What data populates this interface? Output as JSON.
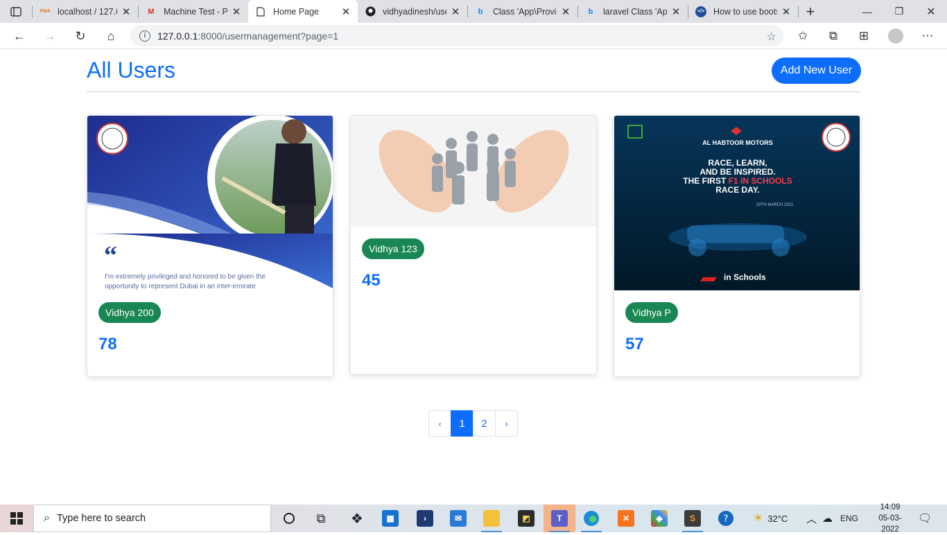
{
  "browser": {
    "tabs": [
      {
        "title": "localhost / 127.0.0",
        "icon": "phpmyadmin-icon",
        "icon_text": "PMA"
      },
      {
        "title": "Machine Test - Ph",
        "icon": "gmail-icon",
        "icon_text": "M"
      },
      {
        "title": "Home Page",
        "icon": "page-icon",
        "icon_text": ""
      },
      {
        "title": "vidhyadinesh/use",
        "icon": "github-icon",
        "icon_text": ""
      },
      {
        "title": "Class 'App\\Provid",
        "icon": "bing-icon",
        "icon_text": "b"
      },
      {
        "title": "laravel Class 'App",
        "icon": "bing-icon",
        "icon_text": "b"
      },
      {
        "title": "How to use boots",
        "icon": "code-icon",
        "icon_text": "</>"
      }
    ],
    "active_tab": 2,
    "url_host": "127.0.0.1",
    "url_rest": ":8000/usermanagement?page=1"
  },
  "page": {
    "title": "All Users",
    "add_button": "Add New User",
    "cards": [
      {
        "name": "Vidhya 200",
        "number": "78",
        "quote_mark": "“",
        "quote_text": "I'm extremely privileged and honored to be given the opportunity to represent Dubai in an inter-emirate"
      },
      {
        "name": "Vidhya 123",
        "number": "45"
      },
      {
        "name": "Vidhya P",
        "number": "57",
        "banner_brand": "AL HABTOOR MOTORS",
        "banner_line1": "RACE, LEARN,",
        "banner_line2": "AND BE INSPIRED.",
        "banner_line3a": "THE FIRST ",
        "banner_line3b": "F1 IN SCHOOLS",
        "banner_line4": "RACE DAY.",
        "banner_date": "20TH MARCH 2021",
        "banner_footer": "in Schools"
      }
    ],
    "pagination": {
      "prev": "‹",
      "pages": [
        "1",
        "2"
      ],
      "current": "1",
      "next": "›"
    }
  },
  "taskbar": {
    "search_placeholder": "Type here to search",
    "weather": "32°C",
    "lang": "ENG",
    "time": "14:09",
    "date": "05-03-2022"
  },
  "colors": {
    "primary": "#0d6efd",
    "badge": "#198754"
  }
}
